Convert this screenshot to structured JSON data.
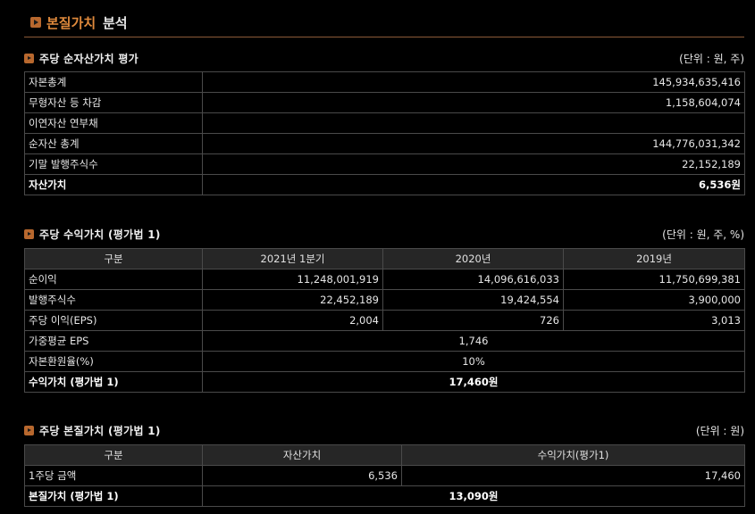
{
  "header": {
    "title_accent": "본질가치",
    "title_rest": "분석"
  },
  "net_asset": {
    "title": "주당 순자산가치 평가",
    "unit": "(단위 : 원, 주)",
    "rows": [
      {
        "label": "자본총계",
        "value": "145,934,635,416"
      },
      {
        "label": "무형자산 등 차감",
        "value": "1,158,604,074"
      },
      {
        "label": "이연자산 연부채",
        "value": ""
      },
      {
        "label": "순자산 총계",
        "value": "144,776,031,342"
      },
      {
        "label": "기말 발행주식수",
        "value": "22,152,189"
      }
    ],
    "total": {
      "label": "자산가치",
      "value": "6,536원"
    }
  },
  "earnings": {
    "title": "주당 수익가치 (평가법 1)",
    "unit": "(단위 : 원, 주, %)",
    "headers": [
      "구분",
      "2021년 1분기",
      "2020년",
      "2019년"
    ],
    "rows": [
      {
        "label": "순이익",
        "values": [
          "11,248,001,919",
          "14,096,616,033",
          "11,750,699,381"
        ]
      },
      {
        "label": "발행주식수",
        "values": [
          "22,452,189",
          "19,424,554",
          "3,900,000"
        ]
      },
      {
        "label": "주당 이익(EPS)",
        "values": [
          "2,004",
          "726",
          "3,013"
        ]
      }
    ],
    "weighted_eps": {
      "label": "가중평균 EPS",
      "value": "1,746"
    },
    "cap_rate": {
      "label": "자본환원율(%)",
      "value": "10%"
    },
    "total": {
      "label": "수익가치 (평가법 1)",
      "value": "17,460원"
    }
  },
  "intrinsic": {
    "title": "주당 본질가치 (평가법 1)",
    "unit": "(단위 : 원)",
    "headers": [
      "구분",
      "자산가치",
      "수익가치(평가1)"
    ],
    "row": {
      "label": "1주당 금액",
      "asset": "6,536",
      "earnings": "17,460"
    },
    "total": {
      "label": "본질가치 (평가법 1)",
      "value": "13,090원"
    }
  }
}
